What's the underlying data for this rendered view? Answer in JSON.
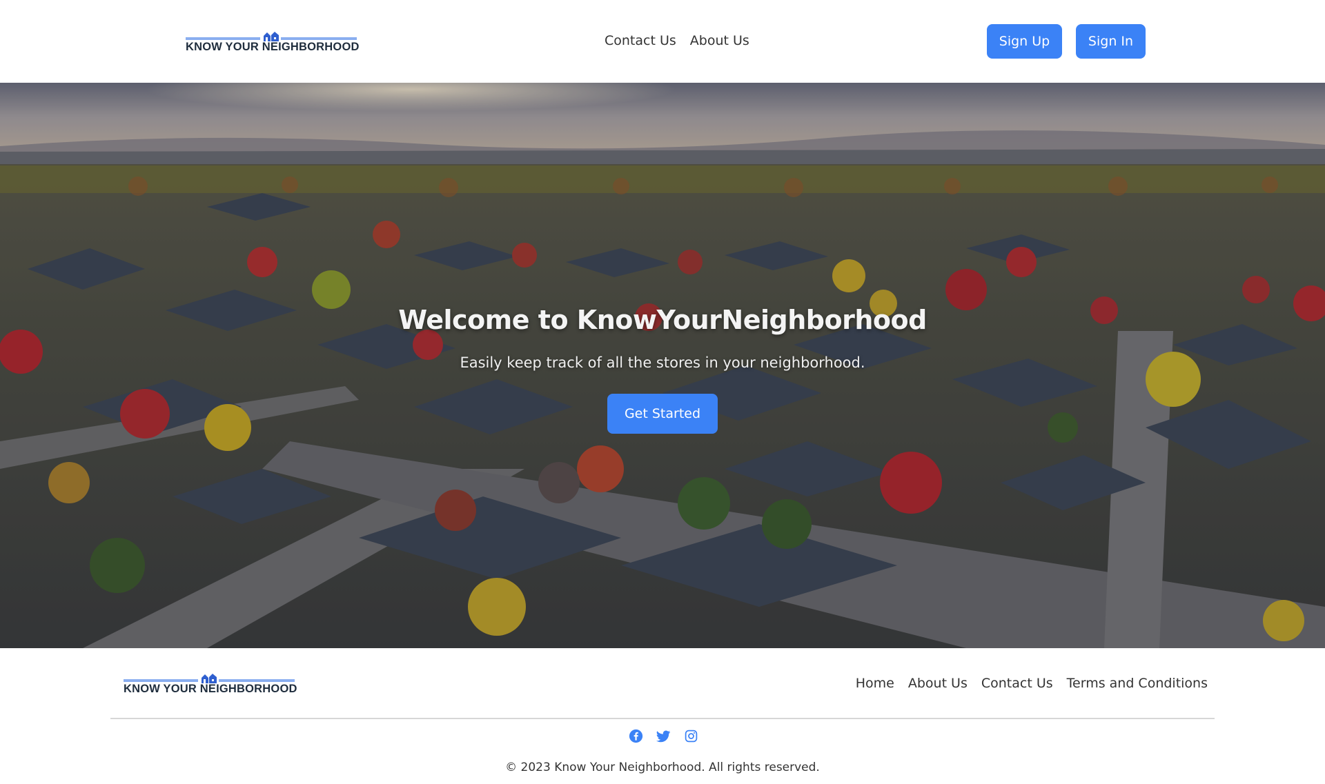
{
  "brand": {
    "logo_text": "KNOW YOUR NEIGHBORHOOD",
    "accent_color": "#3b82f6"
  },
  "header": {
    "nav": [
      {
        "label": "Contact Us"
      },
      {
        "label": "About Us"
      }
    ],
    "sign_up_label": "Sign Up",
    "sign_in_label": "Sign In"
  },
  "hero": {
    "title": "Welcome to KnowYourNeighborhood",
    "subtitle": "Easily keep track of all the stores in your neighborhood.",
    "cta_label": "Get Started",
    "background_image": "aerial view of a suburban neighborhood with autumn trees at sunset"
  },
  "footer": {
    "nav": [
      {
        "label": "Home"
      },
      {
        "label": "About Us"
      },
      {
        "label": "Contact Us"
      },
      {
        "label": "Terms and Conditions"
      }
    ],
    "social_icons": [
      "facebook-icon",
      "twitter-icon",
      "instagram-icon"
    ],
    "copyright": "© 2023 Know Your Neighborhood. All rights reserved."
  }
}
